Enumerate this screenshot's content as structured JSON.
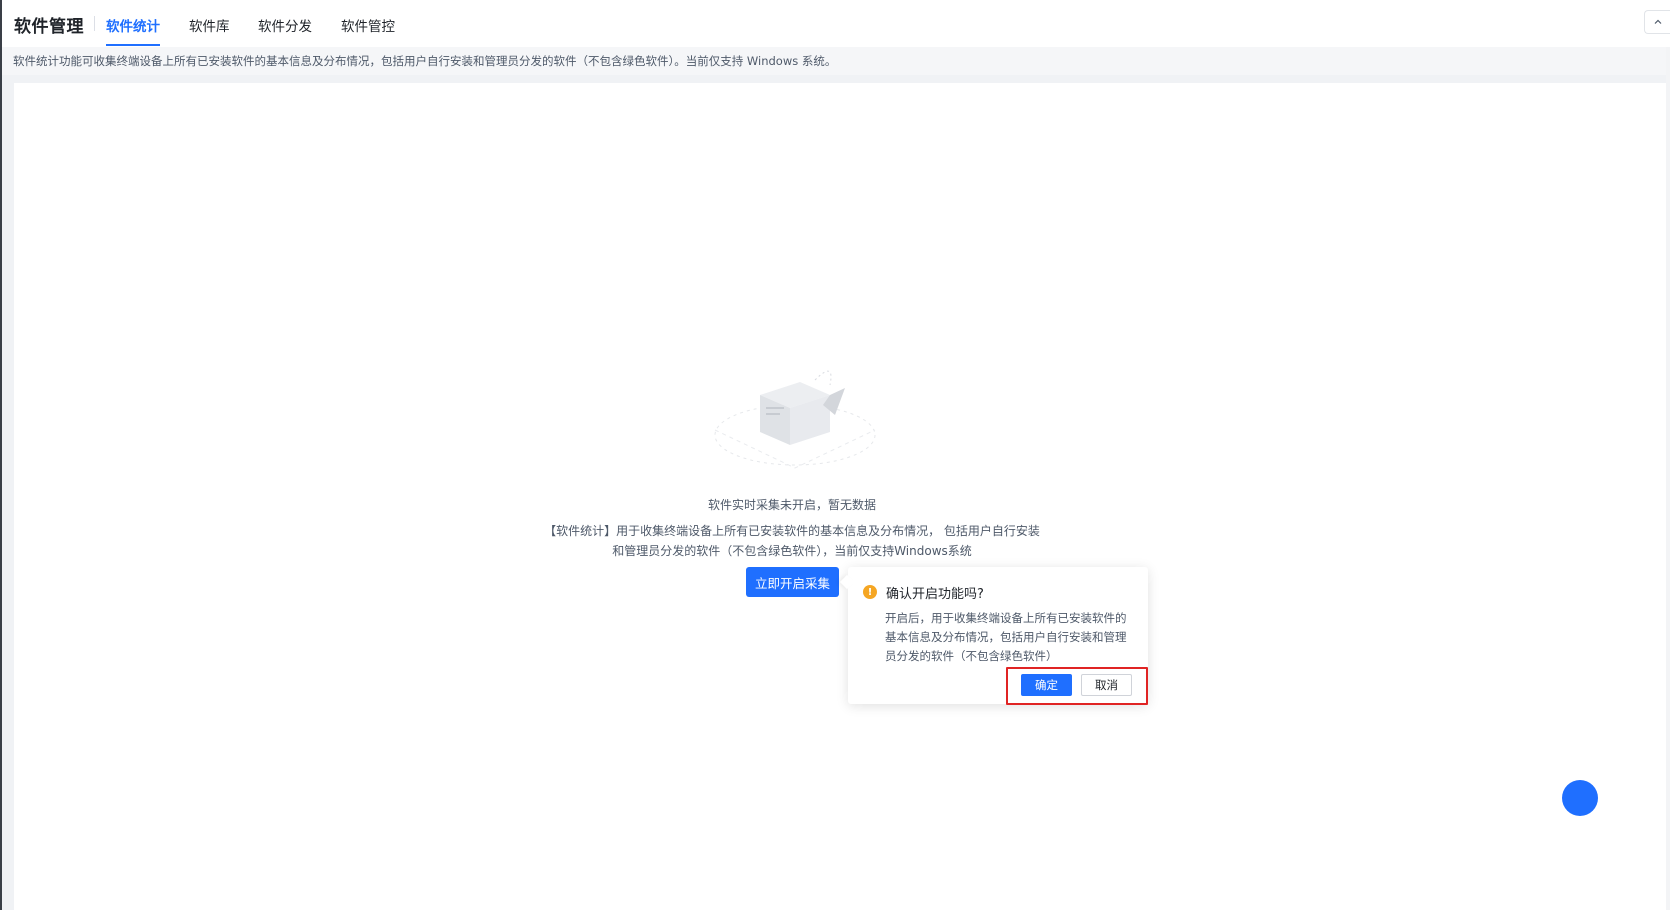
{
  "header": {
    "title": "软件管理",
    "tabs": [
      {
        "label": "软件统计",
        "active": true
      },
      {
        "label": "软件库",
        "active": false
      },
      {
        "label": "软件分发",
        "active": false
      },
      {
        "label": "软件管控",
        "active": false
      }
    ],
    "collapse_icon": "chevron-up-icon"
  },
  "notice": {
    "text": "软件统计功能可收集终端设备上所有已安装软件的基本信息及分布情况，包括用户自行安装和管理员分发的软件（不包含绿色软件）。当前仅支持 Windows 系统。"
  },
  "empty_state": {
    "illustration_icon": "empty-box-icon",
    "title": "软件实时采集未开启，暂无数据",
    "desc_line1": "【软件统计】用于收集终端设备上所有已安装软件的基本信息及分布情况， 包括用户自行安装",
    "desc_line2": "和管理员分发的软件（不包含绿色软件），当前仅支持Windows系统",
    "button_label": "立即开启采集"
  },
  "popconfirm": {
    "icon": "warning-icon",
    "icon_text": "!",
    "title": "确认开启功能吗?",
    "body": "开启后，用于收集终端设备上所有已安装软件的基本信息及分布情况，包括用户自行安装和管理员分发的软件（不包含绿色软件）",
    "ok_label": "确定",
    "cancel_label": "取消"
  },
  "colors": {
    "accent": "#1f6fff",
    "warning": "#f5a623",
    "highlight": "#e02424"
  }
}
